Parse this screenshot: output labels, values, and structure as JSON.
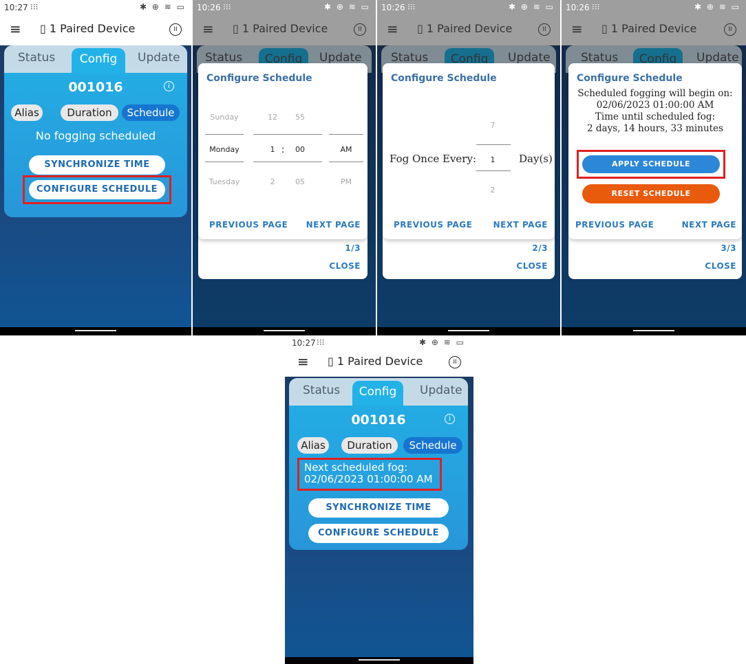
{
  "common": {
    "app_title": "1 Paired Device",
    "menu_icon": "hamburger-icon",
    "pause_icon": "pause-icon",
    "status_icons": "bluetooth vibrate wifi battery",
    "grid_icon": "app-grid-icon",
    "tabs": [
      "Status",
      "Config",
      "Update"
    ],
    "device_id": "001016",
    "chips": [
      "Alias",
      "Duration",
      "Schedule"
    ],
    "sync_label": "SYNCHRONIZE TIME",
    "configure_label": "CONFIGURE SCHEDULE",
    "dialog_title": "Configure Schedule",
    "prev_page": "PREVIOUS PAGE",
    "next_page": "NEXT PAGE",
    "close": "CLOSE",
    "battery": "79",
    "highlight_color": "#e02020"
  },
  "screen1": {
    "time": "10:27",
    "message": "No fogging scheduled"
  },
  "screen2": {
    "time": "10:26",
    "page": "1/3",
    "day_above": "Sunday",
    "day_selected": "Monday",
    "day_below": "Tuesday",
    "hour_above": "12",
    "hour_selected": "1",
    "hour_below": "2",
    "min_above": "55",
    "min_selected": "00",
    "min_below": "05",
    "ampm_selected": "AM",
    "ampm_below": "PM",
    "colon": ":"
  },
  "screen3": {
    "time": "10:26",
    "page": "2/3",
    "label": "Fog Once Every:",
    "above": "7",
    "selected": "1",
    "below": "2",
    "unit": "Day(s)"
  },
  "screen4": {
    "time": "10:26",
    "page": "3/3",
    "line1": "Scheduled fogging will begin on:",
    "line2": "02/06/2023 01:00:00 AM",
    "line3": "Time until scheduled fog:",
    "line4": "2 days, 14 hours, 33 minutes",
    "apply": "APPLY SCHEDULE",
    "reset": "RESET SCHEDULE"
  },
  "screen5": {
    "time": "10:27",
    "next_line1": "Next scheduled fog:",
    "next_line2": "02/06/2023 01:00:00 AM"
  }
}
